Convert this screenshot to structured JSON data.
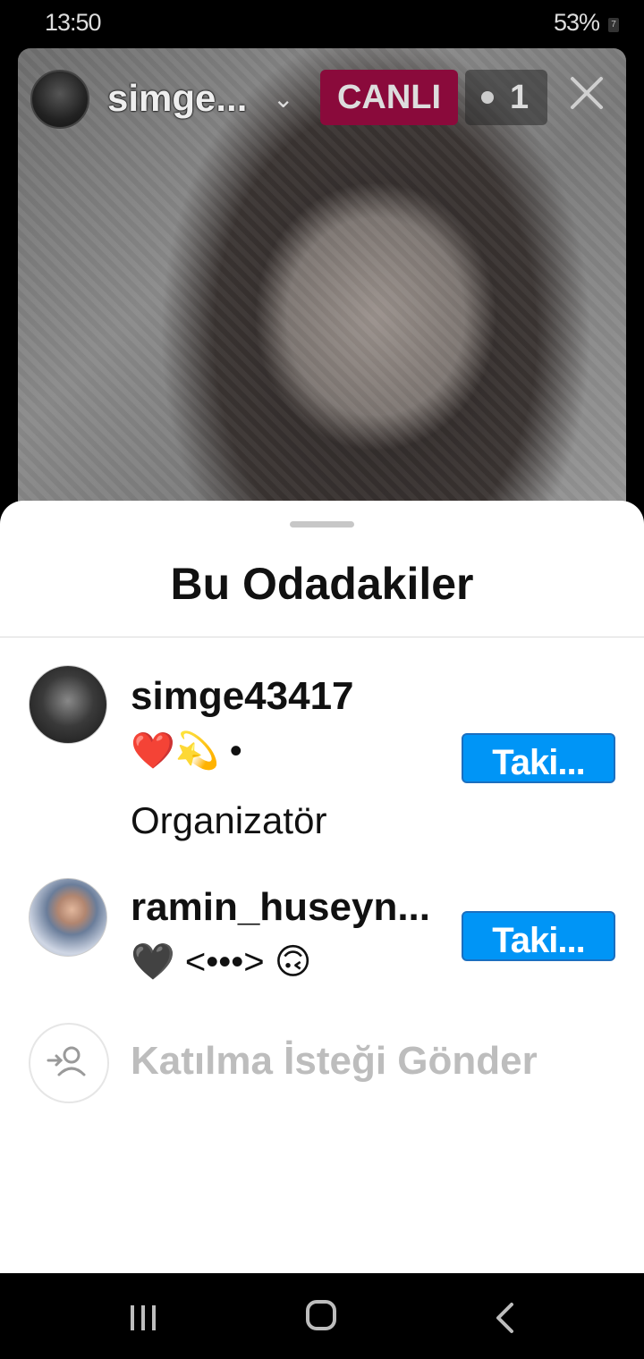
{
  "status_bar": {
    "time": "13:50",
    "battery": "53%",
    "battery_level": "7"
  },
  "live": {
    "host_name": "simge...",
    "badge": "CANLI",
    "viewer_count": "1"
  },
  "sheet": {
    "title": "Bu Odadakiler",
    "participants": [
      {
        "username": "simge43417",
        "bio": "❤️💫 •",
        "role": "Organizatör",
        "follow_label": "Taki..."
      },
      {
        "username": "ramin_huseyn...",
        "bio": "🖤 <•••> 🙃",
        "follow_label": "Taki..."
      }
    ],
    "join_request_label": "Katılma İsteği Gönder"
  },
  "icons": [
    "eye-icon",
    "close-icon",
    "chevron-down-icon",
    "add-person-icon",
    "nav-recent-icon",
    "nav-home-icon",
    "nav-back-icon"
  ],
  "colors": {
    "live_badge": "#8a0a3b",
    "follow_button": "#0095f6"
  }
}
